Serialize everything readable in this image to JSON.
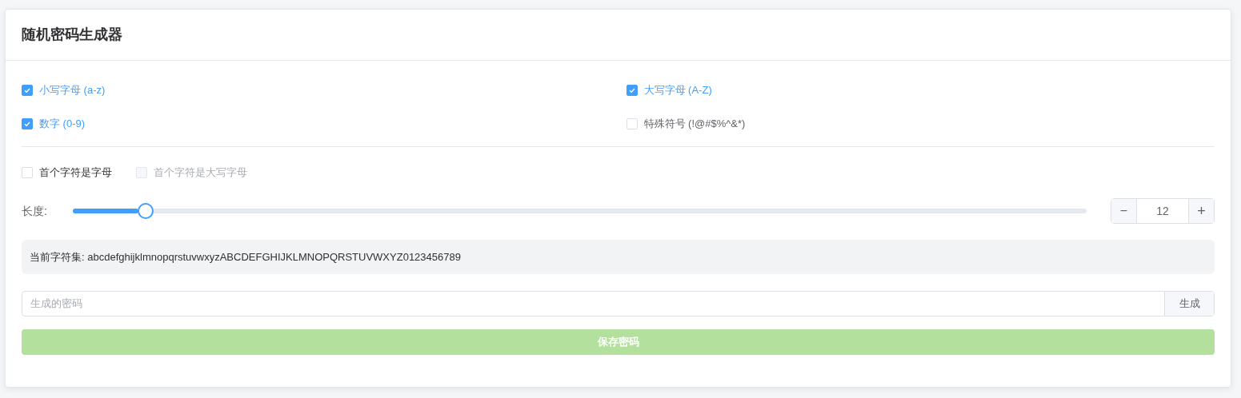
{
  "card": {
    "title": "随机密码生成器"
  },
  "charsets": [
    {
      "label": "小写字母 (a-z)",
      "checked": true
    },
    {
      "label": "大写字母 (A-Z)",
      "checked": true
    },
    {
      "label": "数字 (0-9)",
      "checked": true
    },
    {
      "label": "特殊符号 (!@#$%^&*)",
      "checked": false
    }
  ],
  "first_char": [
    {
      "label": "首个字符是字母",
      "checked": false,
      "disabled": false
    },
    {
      "label": "首个字符是大写字母",
      "checked": false,
      "disabled": true
    }
  ],
  "length": {
    "label": "长度:",
    "level": 0.065,
    "value": "12",
    "minus": "−",
    "plus": "+"
  },
  "charset_info": "当前字符集: abcdefghijklmnopqrstuvwxyzABCDEFGHIJKLMNOPQRSTUVWXYZ0123456789",
  "password": {
    "placeholder": "生成的密码",
    "generate_button": "生成"
  },
  "save_button": {
    "label": "保存密码",
    "disabled": true
  }
}
